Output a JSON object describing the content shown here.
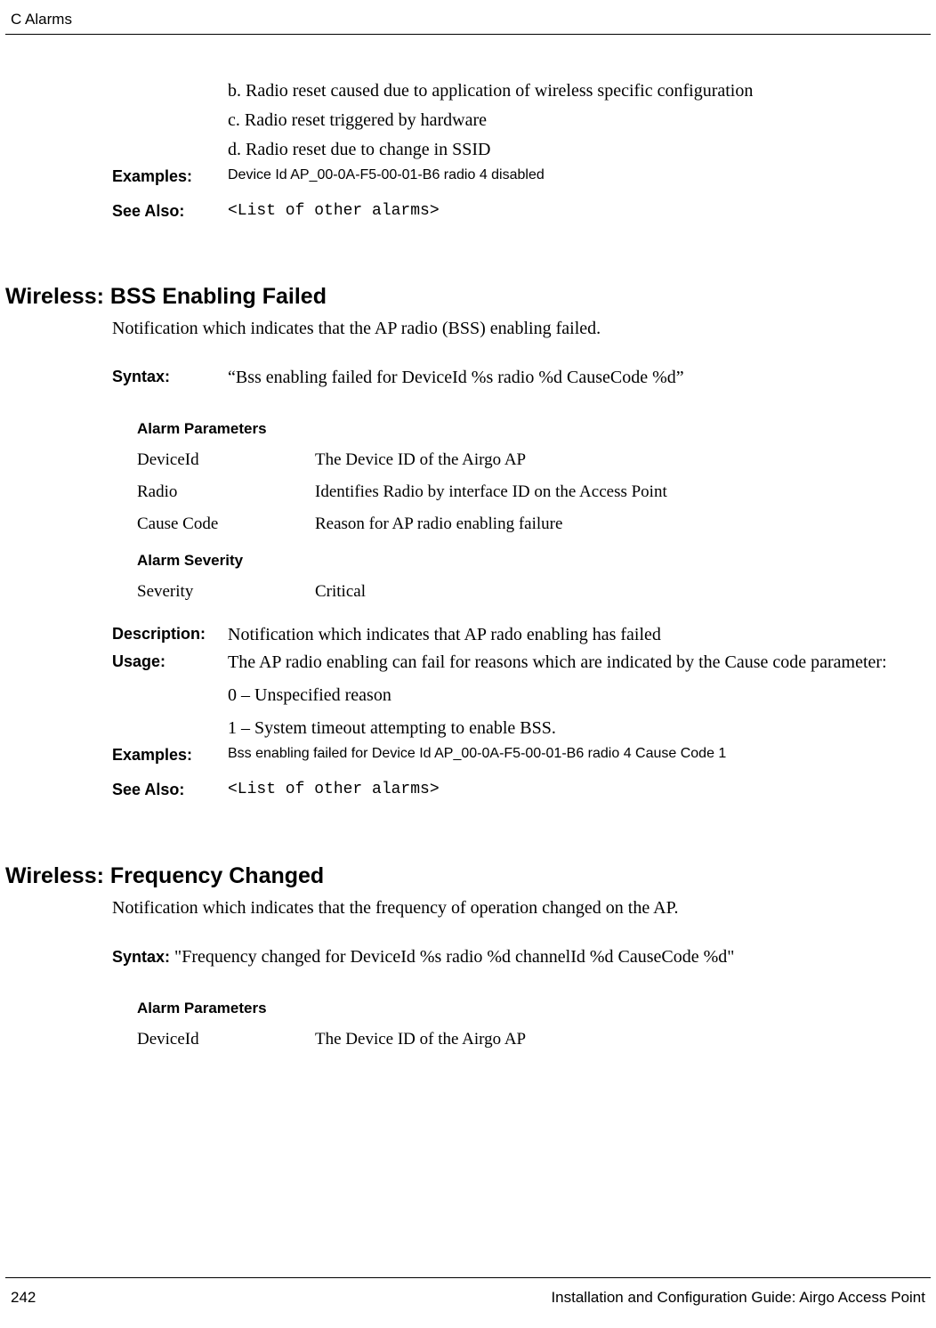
{
  "header": {
    "left": "C  Alarms",
    "right": ""
  },
  "footer": {
    "page": "242",
    "title": "Installation and Configuration Guide: Airgo Access Point"
  },
  "topFragment": {
    "lines": [
      "b. Radio reset caused due to application of wireless specific configuration",
      "c. Radio reset triggered by hardware",
      "d. Radio reset due to change in SSID"
    ],
    "examplesLabel": "Examples:",
    "examplesValue": "Device Id AP_00-0A-F5-00-01-B6 radio 4 disabled",
    "seeAlsoLabel": "See Also:",
    "seeAlsoValue": "<List of other alarms>"
  },
  "section1": {
    "heading": "Wireless: BSS Enabling Failed",
    "intro": "Notification which indicates that the AP radio (BSS) enabling failed.",
    "syntaxLabel": "Syntax:",
    "syntaxValue": "“Bss enabling failed for DeviceId %s radio %d CauseCode %d”",
    "paramsHeading": "Alarm Parameters",
    "params": [
      {
        "name": " DeviceId",
        "desc": "The Device ID of the Airgo AP"
      },
      {
        "name": "Radio",
        "desc": "Identifies Radio by interface ID on the Access Point"
      },
      {
        "name": "Cause Code",
        "desc": "Reason for AP radio enabling failure"
      }
    ],
    "severityHeading": "Alarm Severity",
    "severity": {
      "name": "Severity",
      "desc": "Critical"
    },
    "descriptionLabel": "Description:",
    "descriptionValue": "Notification which indicates that AP rado enabling has failed",
    "usageLabel": "Usage:",
    "usageLines": [
      "The AP radio enabling can fail for reasons which are indicated by the Cause code parameter:",
      "0 – Unspecified reason",
      "1 – System timeout attempting to enable BSS."
    ],
    "examplesLabel": "Examples:",
    "examplesValue": "Bss enabling failed for Device Id AP_00-0A-F5-00-01-B6 radio 4 Cause Code 1",
    "seeAlsoLabel": "See Also:",
    "seeAlsoValue": "<List of other alarms>"
  },
  "section2": {
    "heading": "Wireless: Frequency Changed",
    "intro": "Notification which indicates that the frequency of operation changed on the AP.",
    "syntaxLabel": "Syntax: ",
    "syntaxValue": "\"Frequency changed for DeviceId %s radio %d channelId %d CauseCode %d\"",
    "paramsHeading": "Alarm Parameters",
    "params": [
      {
        "name": "DeviceId",
        "desc": "The Device ID of the Airgo AP"
      }
    ]
  }
}
